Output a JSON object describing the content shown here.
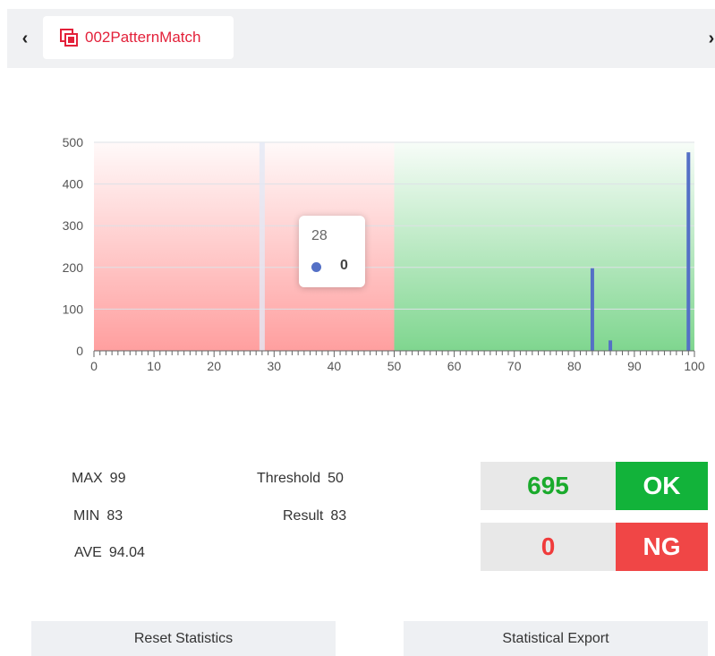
{
  "tab": {
    "label": "002PatternMatch",
    "icon": "layers-icon"
  },
  "nav": {
    "prev": "‹",
    "next": "›"
  },
  "chart_data": {
    "type": "bar",
    "x_ticks": [
      0,
      10,
      20,
      30,
      40,
      50,
      60,
      70,
      80,
      90,
      100
    ],
    "y_ticks": [
      0,
      100,
      200,
      300,
      400,
      500
    ],
    "xlim": [
      0,
      100
    ],
    "ylim": [
      0,
      500
    ],
    "threshold": 50,
    "hover_x": 28,
    "bars": [
      {
        "x": 83,
        "y": 198
      },
      {
        "x": 86,
        "y": 25
      },
      {
        "x": 99,
        "y": 476
      }
    ],
    "ng_color": "#ff9f9f",
    "ok_color": "#7fd68f",
    "bar_color": "#5470c6"
  },
  "tooltip": {
    "title": "28",
    "value": "0"
  },
  "stats": {
    "max_label": "MAX",
    "max_value": "99",
    "min_label": "MIN",
    "min_value": "83",
    "ave_label": "AVE",
    "ave_value": "94.04",
    "threshold_label": "Threshold",
    "threshold_value": "50",
    "result_label": "Result",
    "result_value": "83"
  },
  "ok": {
    "count": "695",
    "label": "OK",
    "count_color": "#1aaa2c",
    "tag_color": "#12b33a"
  },
  "ng": {
    "count": "0",
    "label": "NG",
    "count_color": "#f03b3b",
    "tag_color": "#f04646"
  },
  "buttons": {
    "reset": "Reset Statistics",
    "export": "Statistical Export"
  }
}
